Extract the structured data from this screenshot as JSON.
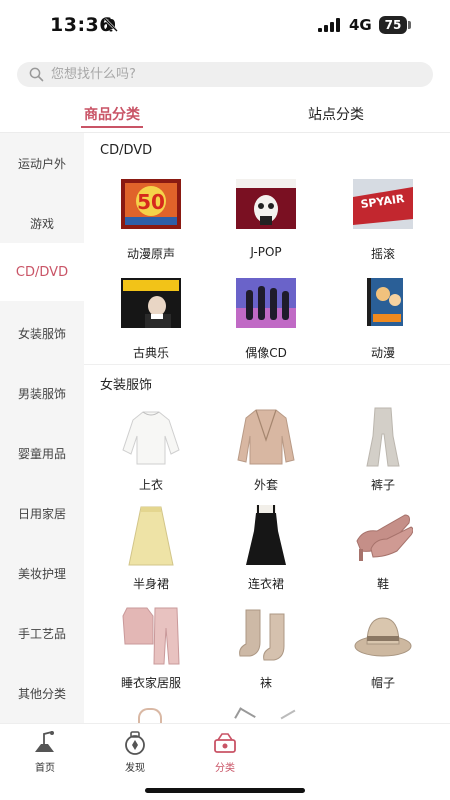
{
  "status_bar": {
    "time": "13:36",
    "network": "4G",
    "battery": "75"
  },
  "search": {
    "placeholder": "您想找什么吗?"
  },
  "tabs": [
    {
      "label": "商品分类",
      "active": true
    },
    {
      "label": "站点分类",
      "active": false
    }
  ],
  "sidebar": {
    "items": [
      {
        "label": "运动户外"
      },
      {
        "label": "游戏"
      },
      {
        "label": "CD/DVD",
        "active": true
      },
      {
        "label": "女装服饰"
      },
      {
        "label": "男装服饰"
      },
      {
        "label": "婴童用品"
      },
      {
        "label": "日用家居"
      },
      {
        "label": "美妆护理"
      },
      {
        "label": "手工艺品"
      },
      {
        "label": "其他分类"
      }
    ]
  },
  "sections": [
    {
      "title": "CD/DVD",
      "items": [
        {
          "label": "动漫原声",
          "icon": "anime-soundtrack-cd-image"
        },
        {
          "label": "J-POP",
          "icon": "jpop-cd-image"
        },
        {
          "label": "摇滚",
          "icon": "rock-cd-image"
        },
        {
          "label": "古典乐",
          "icon": "classical-cd-image"
        },
        {
          "label": "偶像CD",
          "icon": "idol-cd-image"
        },
        {
          "label": "动漫",
          "icon": "anime-dvd-image"
        }
      ]
    },
    {
      "title": "女装服饰",
      "items": [
        {
          "label": "上衣",
          "icon": "blouse-image"
        },
        {
          "label": "外套",
          "icon": "jacket-image"
        },
        {
          "label": "裤子",
          "icon": "pants-image"
        },
        {
          "label": "半身裙",
          "icon": "skirt-image"
        },
        {
          "label": "连衣裙",
          "icon": "dress-image"
        },
        {
          "label": "鞋",
          "icon": "shoes-image"
        },
        {
          "label": "睡衣家居服",
          "icon": "pajamas-image"
        },
        {
          "label": "袜",
          "icon": "socks-image"
        },
        {
          "label": "帽子",
          "icon": "hat-image"
        }
      ]
    }
  ],
  "bottom_nav": [
    {
      "label": "首页",
      "icon": "home-icon"
    },
    {
      "label": "发现",
      "icon": "discover-icon"
    },
    {
      "label": "分类",
      "icon": "category-icon",
      "active": true
    }
  ],
  "colors": {
    "accent": "#c95466",
    "sidebar_bg": "#f5f5f5",
    "search_bg": "#efefef"
  }
}
